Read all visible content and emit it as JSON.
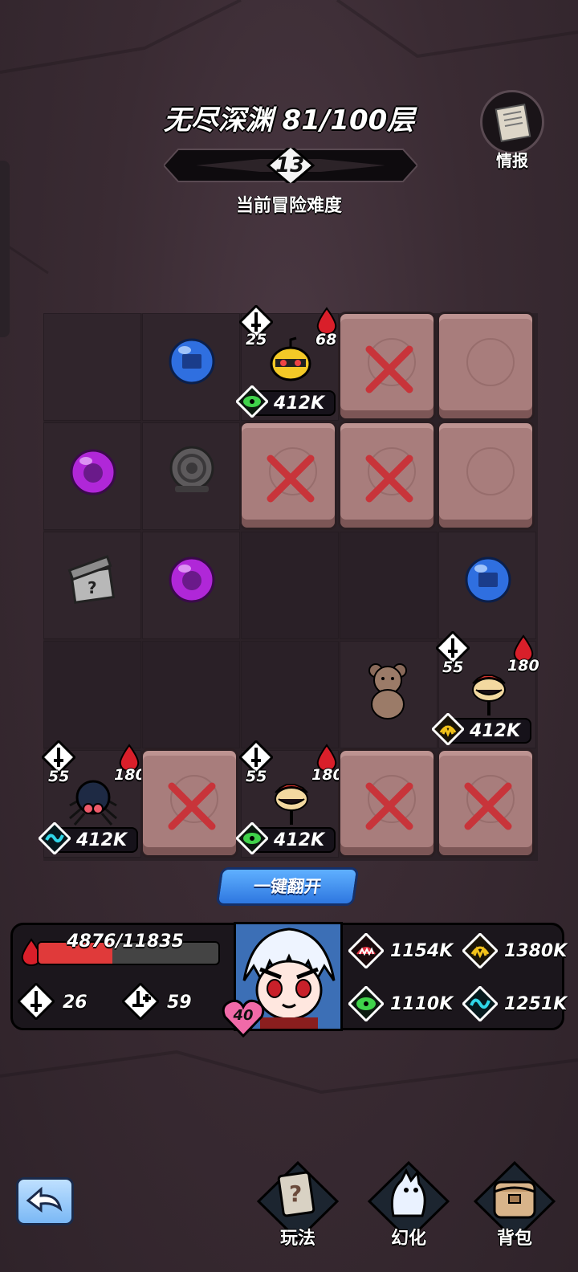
{
  "header": {
    "title": "无尽深渊 81/100层",
    "difficulty_level": "13",
    "difficulty_label": "当前冒险难度",
    "info_label": "情报"
  },
  "board": {
    "enemies": [
      {
        "name": "yellow-bomb-creature",
        "attack": "25",
        "hp": "68",
        "power": "412K",
        "element": "green-eye"
      },
      {
        "name": "red-cap-flytrap",
        "attack": "55",
        "hp": "180",
        "power": "412K",
        "element": "yellow-fang"
      },
      {
        "name": "black-spider",
        "attack": "55",
        "hp": "180",
        "power": "412K",
        "element": "cyan-wave"
      },
      {
        "name": "red-cap-flytrap-2",
        "attack": "55",
        "hp": "180",
        "power": "412K",
        "element": "green-eye"
      }
    ]
  },
  "actions": {
    "flip_all_label": "一键翻开"
  },
  "player": {
    "hp_text": "4876/11835",
    "hp_current": 4876,
    "hp_max": 11835,
    "attack": "26",
    "crit": "59",
    "level": "40",
    "stats": {
      "red": "1154K",
      "yellow": "1380K",
      "green": "1110K",
      "cyan": "1251K"
    }
  },
  "nav": {
    "gameplay": "玩法",
    "transform": "幻化",
    "backpack": "背包"
  },
  "colors": {
    "rock": "#a87d7c",
    "x_mark": "#c8343a",
    "flip_button": "#3f8ef0",
    "hp_fill": "#e03a3a"
  }
}
